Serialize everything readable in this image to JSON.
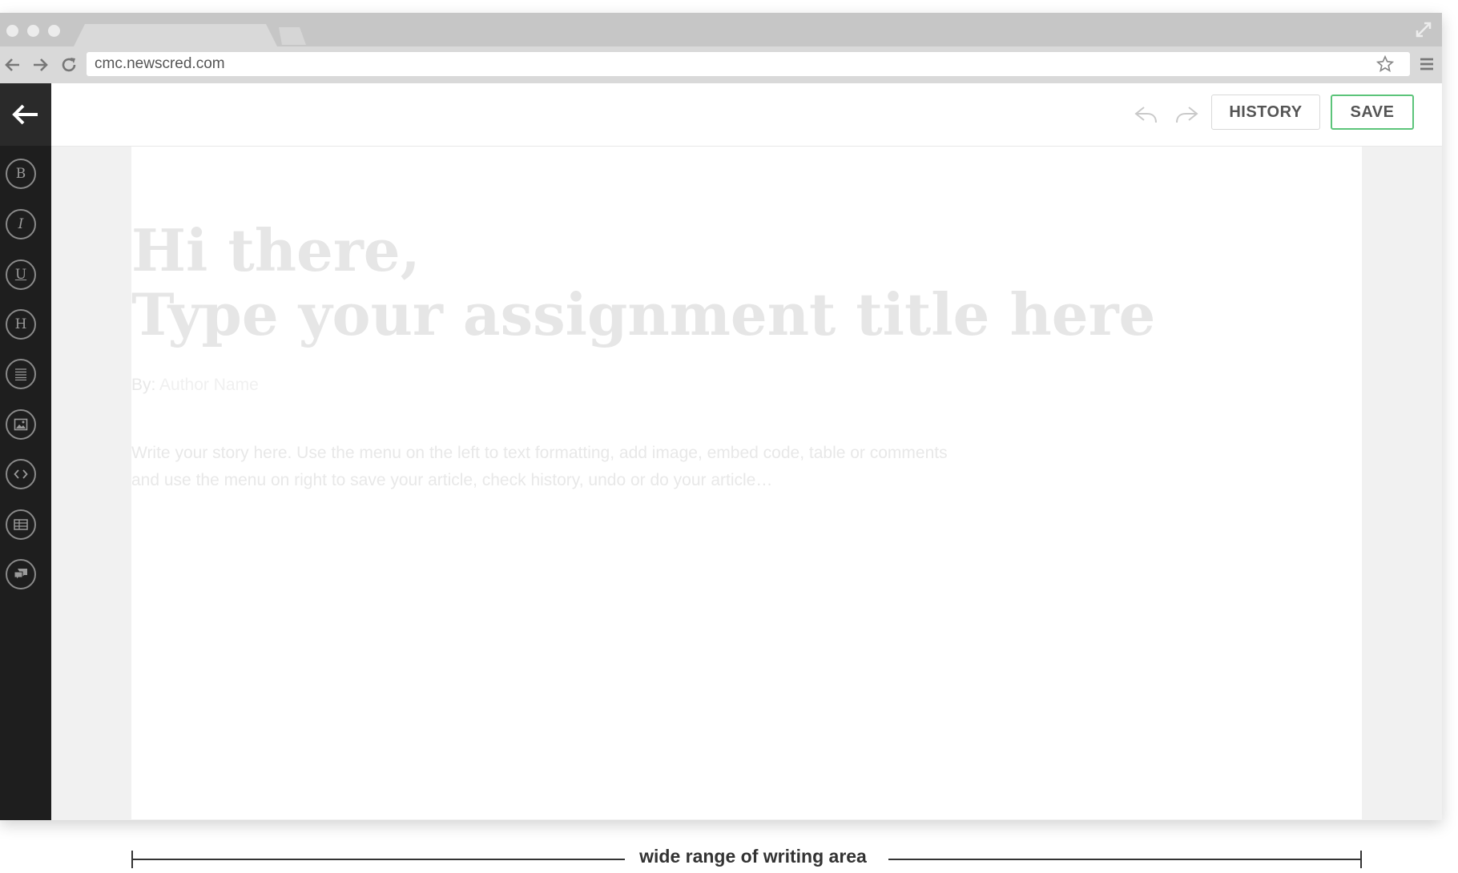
{
  "browser": {
    "url": "cmc.newscred.com"
  },
  "toolbar": {
    "history_label": "HISTORY",
    "save_label": "SAVE"
  },
  "sidebar": {
    "tools": [
      {
        "icon": "bold-icon",
        "glyph": "B"
      },
      {
        "icon": "italic-icon",
        "glyph": "I"
      },
      {
        "icon": "underline-icon",
        "glyph": "U"
      },
      {
        "icon": "heading-icon",
        "glyph": "H"
      },
      {
        "icon": "paragraph-icon"
      },
      {
        "icon": "image-icon"
      },
      {
        "icon": "embed-code-icon"
      },
      {
        "icon": "table-icon"
      },
      {
        "icon": "comment-icon"
      }
    ]
  },
  "editor": {
    "greeting_line1": "Hi there,",
    "greeting_line2": "Type your assignment title here",
    "byline_prefix": "By:",
    "author_placeholder": "Author Name",
    "body_line1": "Write your story here. Use the menu on the left to text formatting, add image, embed code, table or comments",
    "body_line2": "and use the menu on right to save your article, check history, undo or do your article…"
  },
  "annotation": {
    "caption": "wide range of writing area"
  },
  "colors": {
    "sidebar": "#1e1e1e",
    "save_border": "#5cc47a",
    "placeholder": "#e6e6e6"
  }
}
